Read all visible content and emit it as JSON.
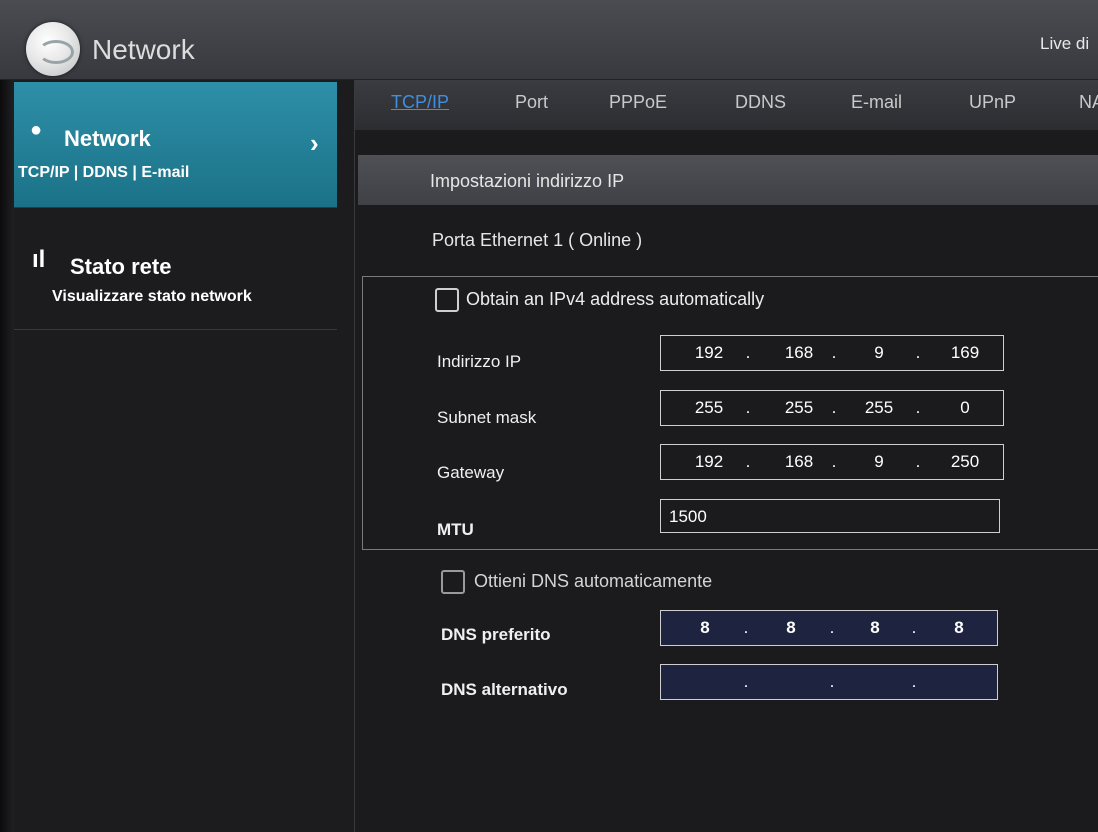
{
  "header": {
    "title": "Network",
    "right_link": "Live di"
  },
  "sidebar": {
    "items": [
      {
        "icon": "globe-icon",
        "title": "Network",
        "subtitle": "TCP/IP | DDNS | E-mail",
        "active": true
      },
      {
        "icon": "signal-icon",
        "title": "Stato rete",
        "subtitle": "Visualizzare stato network",
        "active": false
      }
    ]
  },
  "tabs": [
    {
      "label": "TCP/IP",
      "active": true
    },
    {
      "label": "Port",
      "active": false
    },
    {
      "label": "PPPoE",
      "active": false
    },
    {
      "label": "DDNS",
      "active": false
    },
    {
      "label": "E-mail",
      "active": false
    },
    {
      "label": "UPnP",
      "active": false
    },
    {
      "label": "NA",
      "active": false
    }
  ],
  "main": {
    "section_title": "Impostazioni indirizzo IP",
    "port_status": "Porta Ethernet 1 ( Online )",
    "ipv4_auto": {
      "label": "Obtain an IPv4 address automatically",
      "checked": false
    },
    "ip_address": {
      "label": "Indirizzo IP",
      "octets": [
        "192",
        "168",
        "9",
        "169"
      ]
    },
    "subnet_mask": {
      "label": "Subnet mask",
      "octets": [
        "255",
        "255",
        "255",
        "0"
      ]
    },
    "gateway": {
      "label": "Gateway",
      "octets": [
        "192",
        "168",
        "9",
        "250"
      ]
    },
    "mtu": {
      "label": "MTU",
      "value": "1500"
    },
    "dns_auto": {
      "label": "Ottieni DNS automaticamente",
      "checked": false
    },
    "dns_preferred": {
      "label": "DNS preferito",
      "octets": [
        "8",
        "8",
        "8",
        "8"
      ]
    },
    "dns_alternate": {
      "label": "DNS alternativo",
      "octets": [
        "",
        "",
        "",
        ""
      ]
    }
  },
  "colors": {
    "accent": "#2d8fa8",
    "active_tab": "#3f8fe0"
  }
}
